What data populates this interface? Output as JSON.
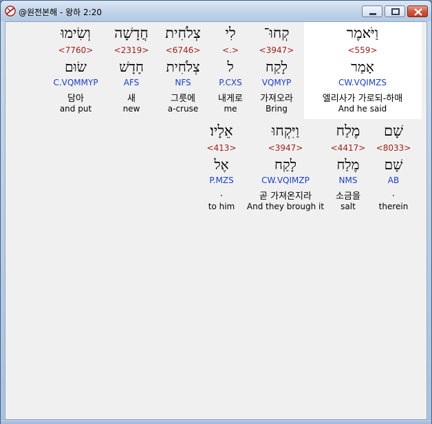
{
  "window": {
    "title": "@원전본해 - 왕하 2:20"
  },
  "words": [
    {
      "heb": "וַיֹּאמֶר",
      "strong": "<559>",
      "root": "אָמַר",
      "morph": "CW.VQIMZS",
      "ko": "엘리사가 가로되-하매",
      "en": "And he said"
    },
    {
      "heb": "קְחוּ־",
      "strong": "<3947>",
      "root": "לָקַח",
      "morph": "VQMYP",
      "ko": "가져오라",
      "en": "Bring"
    },
    {
      "heb": "לִי",
      "strong": "<.>",
      "root": "ל",
      "morph": "P.CXS",
      "ko": "내게로",
      "en": "me"
    },
    {
      "heb": "צְלֹחִית",
      "strong": "<6746>",
      "root": "צְלֹחִית",
      "morph": "NFS",
      "ko": "그릇에",
      "en": "a-cruse"
    },
    {
      "heb": "חֲדָשָׁה",
      "strong": "<2319>",
      "root": "חָדָשׁ",
      "morph": "AFS",
      "ko": "새",
      "en": "new"
    },
    {
      "heb": "וְשִׂימוּ",
      "strong": "<7760>",
      "root": "שׂוּם",
      "morph": "C.VQMMYP",
      "ko": "담아",
      "en": "and put"
    },
    {
      "heb": "שָׁם",
      "strong": "<8033>",
      "root": "שָׁם",
      "morph": "AB",
      "ko": ".",
      "en": "therein"
    },
    {
      "heb": "מֶלַח",
      "strong": "<4417>",
      "root": "מֶלַח",
      "morph": "NMS",
      "ko": "소금을",
      "en": "salt"
    },
    {
      "heb": "וַיִּקְחוּ",
      "strong": "<3947>",
      "root": "לָקַח",
      "morph": "CW.VQIMZP",
      "ko": "곧 가져온지라",
      "en": "And they brough it"
    },
    {
      "heb": "אֵלָיו׃",
      "strong": "<413>",
      "root": "אֶל",
      "morph": "P.MZS",
      "ko": ".",
      "en": "to him"
    }
  ]
}
